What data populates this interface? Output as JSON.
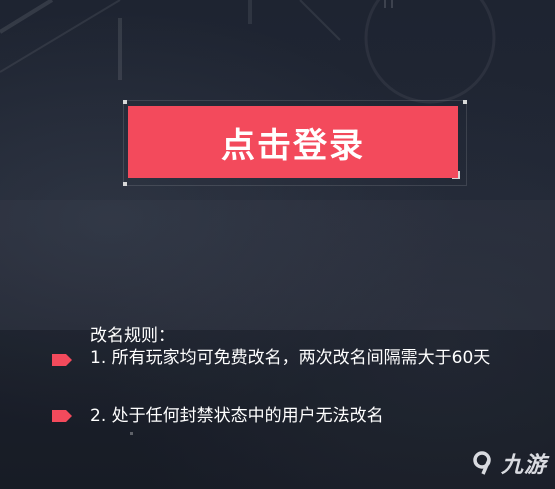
{
  "login": {
    "label": "点击登录"
  },
  "rules": {
    "title": "改名规则：",
    "items": [
      "1. 所有玩家均可免费改名，两次改名间隔需大于60天",
      "2. 处于任何封禁状态中的用户无法改名"
    ]
  },
  "logo": {
    "text": "九游",
    "icon": "9-game-logo-icon"
  },
  "colors": {
    "accent": "#f34a5c",
    "background": "#1c2230",
    "text": "#ffffff"
  }
}
